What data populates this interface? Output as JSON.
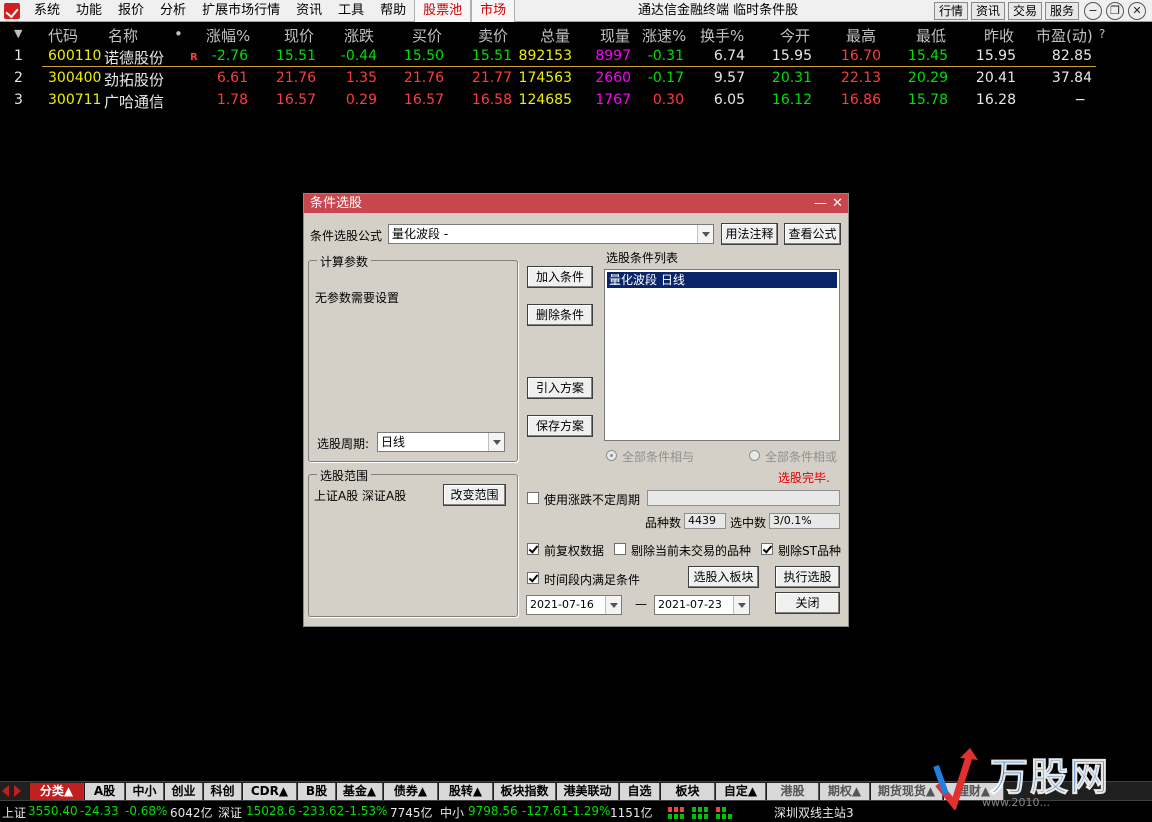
{
  "menubar": {
    "items": [
      "系统",
      "功能",
      "报价",
      "分析",
      "扩展市场行情",
      "资讯",
      "工具",
      "帮助"
    ],
    "highlight_items": [
      "股票池",
      "市场"
    ],
    "app_title": "通达信金融终端  临时条件股",
    "right_buttons": [
      "行情",
      "资讯",
      "交易",
      "服务"
    ]
  },
  "table": {
    "sort_marker": "▼",
    "headers": [
      "代码",
      "名称",
      "•",
      "涨幅%",
      "现价",
      "涨跌",
      "买价",
      "卖价",
      "总量",
      "现量",
      "涨速%",
      "换手%",
      "今开",
      "最高",
      "最低",
      "昨收",
      "市盈(动)",
      "?"
    ],
    "rows": [
      {
        "idx": "1",
        "code": "600110",
        "name": "诺德股份",
        "flag": "R",
        "pct": "-2.76",
        "price": "15.51",
        "chg": "-0.44",
        "bid": "15.50",
        "ask": "15.51",
        "vol": "892153",
        "cur": "8997",
        "speed": "-0.31",
        "turn": "6.74",
        "open": "15.95",
        "high": "16.70",
        "low": "15.45",
        "prev": "15.95",
        "pe": "82.85"
      },
      {
        "idx": "2",
        "code": "300400",
        "name": "劲拓股份",
        "flag": "",
        "pct": "6.61",
        "price": "21.76",
        "chg": "1.35",
        "bid": "21.76",
        "ask": "21.77",
        "vol": "174563",
        "cur": "2660",
        "speed": "-0.17",
        "turn": "9.57",
        "open": "20.31",
        "high": "22.13",
        "low": "20.29",
        "prev": "20.41",
        "pe": "37.84"
      },
      {
        "idx": "3",
        "code": "300711",
        "name": "广哈通信",
        "flag": "",
        "pct": "1.78",
        "price": "16.57",
        "chg": "0.29",
        "bid": "16.57",
        "ask": "16.58",
        "vol": "124685",
        "cur": "1767",
        "speed": "0.30",
        "turn": "6.05",
        "open": "16.12",
        "high": "16.86",
        "low": "15.78",
        "prev": "16.28",
        "pe": "−"
      }
    ]
  },
  "dialog": {
    "title": "条件选股",
    "min_glyph": "—",
    "close_glyph": "✕",
    "formula_label": "条件选股公式",
    "formula_value": "量化波段        -",
    "usage_button": "用法注释",
    "view_formula_button": "查看公式",
    "calc_params_label": "计算参数",
    "no_params_text": "无参数需要设置",
    "period_label": "选股周期:",
    "period_value": "日线",
    "add_button": "加入条件",
    "delete_button": "删除条件",
    "import_button": "引入方案",
    "save_button": "保存方案",
    "cond_list_label": "选股条件列表",
    "cond_item": "量化波段   日线",
    "radio_and": "全部条件相与",
    "radio_or": "全部条件相或",
    "done_text": "选股完毕.",
    "range_label": "选股范围",
    "range_value": "上证A股  深证A股",
    "change_range_button": "改变范围",
    "variable_period_label": "使用涨跌不定周期",
    "count_label": "品种数",
    "count_value": "4439",
    "selected_label": "选中数",
    "selected_value": "3/0.1%",
    "adjust_label": "前复权数据",
    "exclude_untraded_label": "剔除当前未交易的品种",
    "exclude_st_label": "剔除ST品种",
    "period_satisfy_label": "时间段内满足条件",
    "to_block_button": "选股入板块",
    "execute_button": "执行选股",
    "date_from": "2021-07-16",
    "date_sep": "—",
    "date_to": "2021-07-23",
    "close_button": "关闭"
  },
  "tabs": [
    "分类▲",
    "A股",
    "中小",
    "创业",
    "科创",
    "CDR▲",
    "B股",
    "基金▲",
    "债券▲",
    "股转▲",
    "板块指数",
    "港美联动",
    "自选",
    "板块",
    "自定▲",
    "港股",
    "期权▲",
    "期货现货▲",
    "理财▲"
  ],
  "status": {
    "sh_label": "上证",
    "sh_index": "3550.40",
    "sh_chg": "-24.33",
    "sh_pct": "-0.68%",
    "sh_amt": "6042亿",
    "sz_label": "深证",
    "sz_index": "15028.6",
    "sz_chg": "-233.62",
    "sz_pct": "-1.53%",
    "sz_amt": "7745亿",
    "zx_label": "中小",
    "zx_index": "9798.56",
    "zx_chg": "-127.61",
    "zx_pct": "-1.29%",
    "zx_amt": "1151亿",
    "server": "深圳双线主站3"
  },
  "watermark": {
    "text": "万股网",
    "url": "www.2010..."
  }
}
